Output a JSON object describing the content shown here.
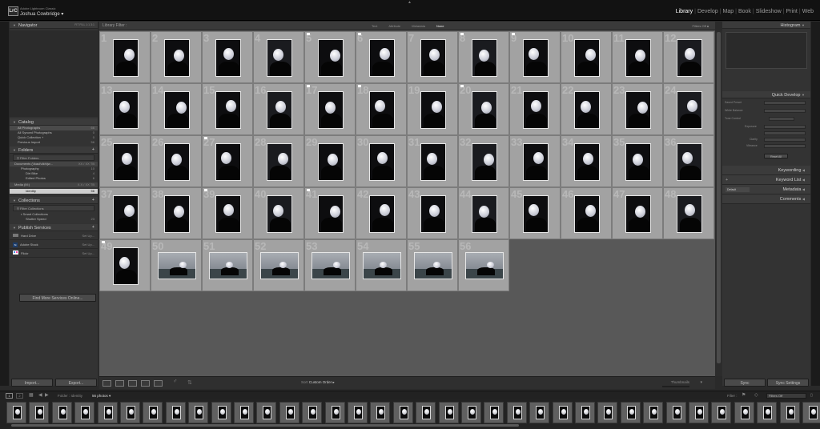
{
  "app": {
    "name": "Adobe Lightroom Classic",
    "user": "Joshua Cowbridge",
    "logo": "LrC"
  },
  "modules": [
    "Library",
    "Develop",
    "Map",
    "Book",
    "Slideshow",
    "Print",
    "Web"
  ],
  "active_module": "Library",
  "left": {
    "navigator": {
      "title": "Navigator",
      "zoom": [
        "FIT",
        "FILL",
        "1:1",
        "3:1"
      ]
    },
    "catalog": {
      "title": "Catalog",
      "items": [
        {
          "label": "All Photographs",
          "count": "66"
        },
        {
          "label": "All Synced Photographs",
          "count": "0"
        },
        {
          "label": "Quick Collection +",
          "count": "0"
        },
        {
          "label": "Previous Import",
          "count": "56"
        }
      ]
    },
    "folders": {
      "title": "Folders",
      "filter": "Filter Folders",
      "volumes": [
        {
          "label": "Documents (\\\\kaul\\dkh\\jw...",
          "size": "XX / XX TB"
        },
        {
          "label": "Media (M:)",
          "size": "X.X / XX TB"
        }
      ],
      "items": [
        {
          "label": "Photography",
          "count": "10"
        },
        {
          "label": "Dirt Bike",
          "count": "4"
        },
        {
          "label": "Edited Photos",
          "count": "6"
        }
      ],
      "selected": {
        "label": "Identity",
        "count": "56"
      }
    },
    "collections": {
      "title": "Collections",
      "filter": "Filter Collections",
      "items": [
        {
          "label": "Smart Collections",
          "count": ""
        },
        {
          "label": "Shutter Speed",
          "count": "23"
        }
      ]
    },
    "publish": {
      "title": "Publish Services",
      "items": [
        {
          "label": "Hard Drive",
          "action": "Set Up..."
        },
        {
          "label": "Adobe Stock",
          "action": "Set Up..."
        },
        {
          "label": "Flickr",
          "action": "Set Up..."
        }
      ],
      "find_more": "Find More Services Online..."
    },
    "import": "Import...",
    "export": "Export..."
  },
  "filterbar": {
    "label": "Library Filter :",
    "options": [
      "Text",
      "Attribute",
      "Metadata",
      "None"
    ],
    "active": "None",
    "filters_off": "Filters Off"
  },
  "grid": {
    "count": 56,
    "flagged": [
      5,
      6,
      8,
      9,
      17,
      18,
      20,
      27,
      39,
      41,
      49
    ],
    "landscape": [
      50,
      51,
      52,
      53,
      54,
      55,
      56
    ]
  },
  "toolbar": {
    "sort_label": "Sort :",
    "sort_value": "Custom Order",
    "thumbs_label": "Thumbnails"
  },
  "right": {
    "histogram": "Histogram",
    "quick_develop": {
      "title": "Quick Develop",
      "rows": [
        "Saved Preset",
        "White Balance",
        "Tone Control",
        "Exposure",
        "Clarity",
        "Vibrance"
      ],
      "reset": "Reset All"
    },
    "panels": [
      "Keywording",
      "Keyword List",
      "Metadata",
      "Comments"
    ],
    "metadata_preset": "Default",
    "sync": "Sync",
    "sync_settings": "Sync Settings"
  },
  "filmstrip": {
    "path": "Folder : Identity",
    "count_label": "56 photos",
    "filter_label": "Filter :",
    "filter_value": "Filters Off",
    "pages": [
      "1",
      "2"
    ]
  }
}
